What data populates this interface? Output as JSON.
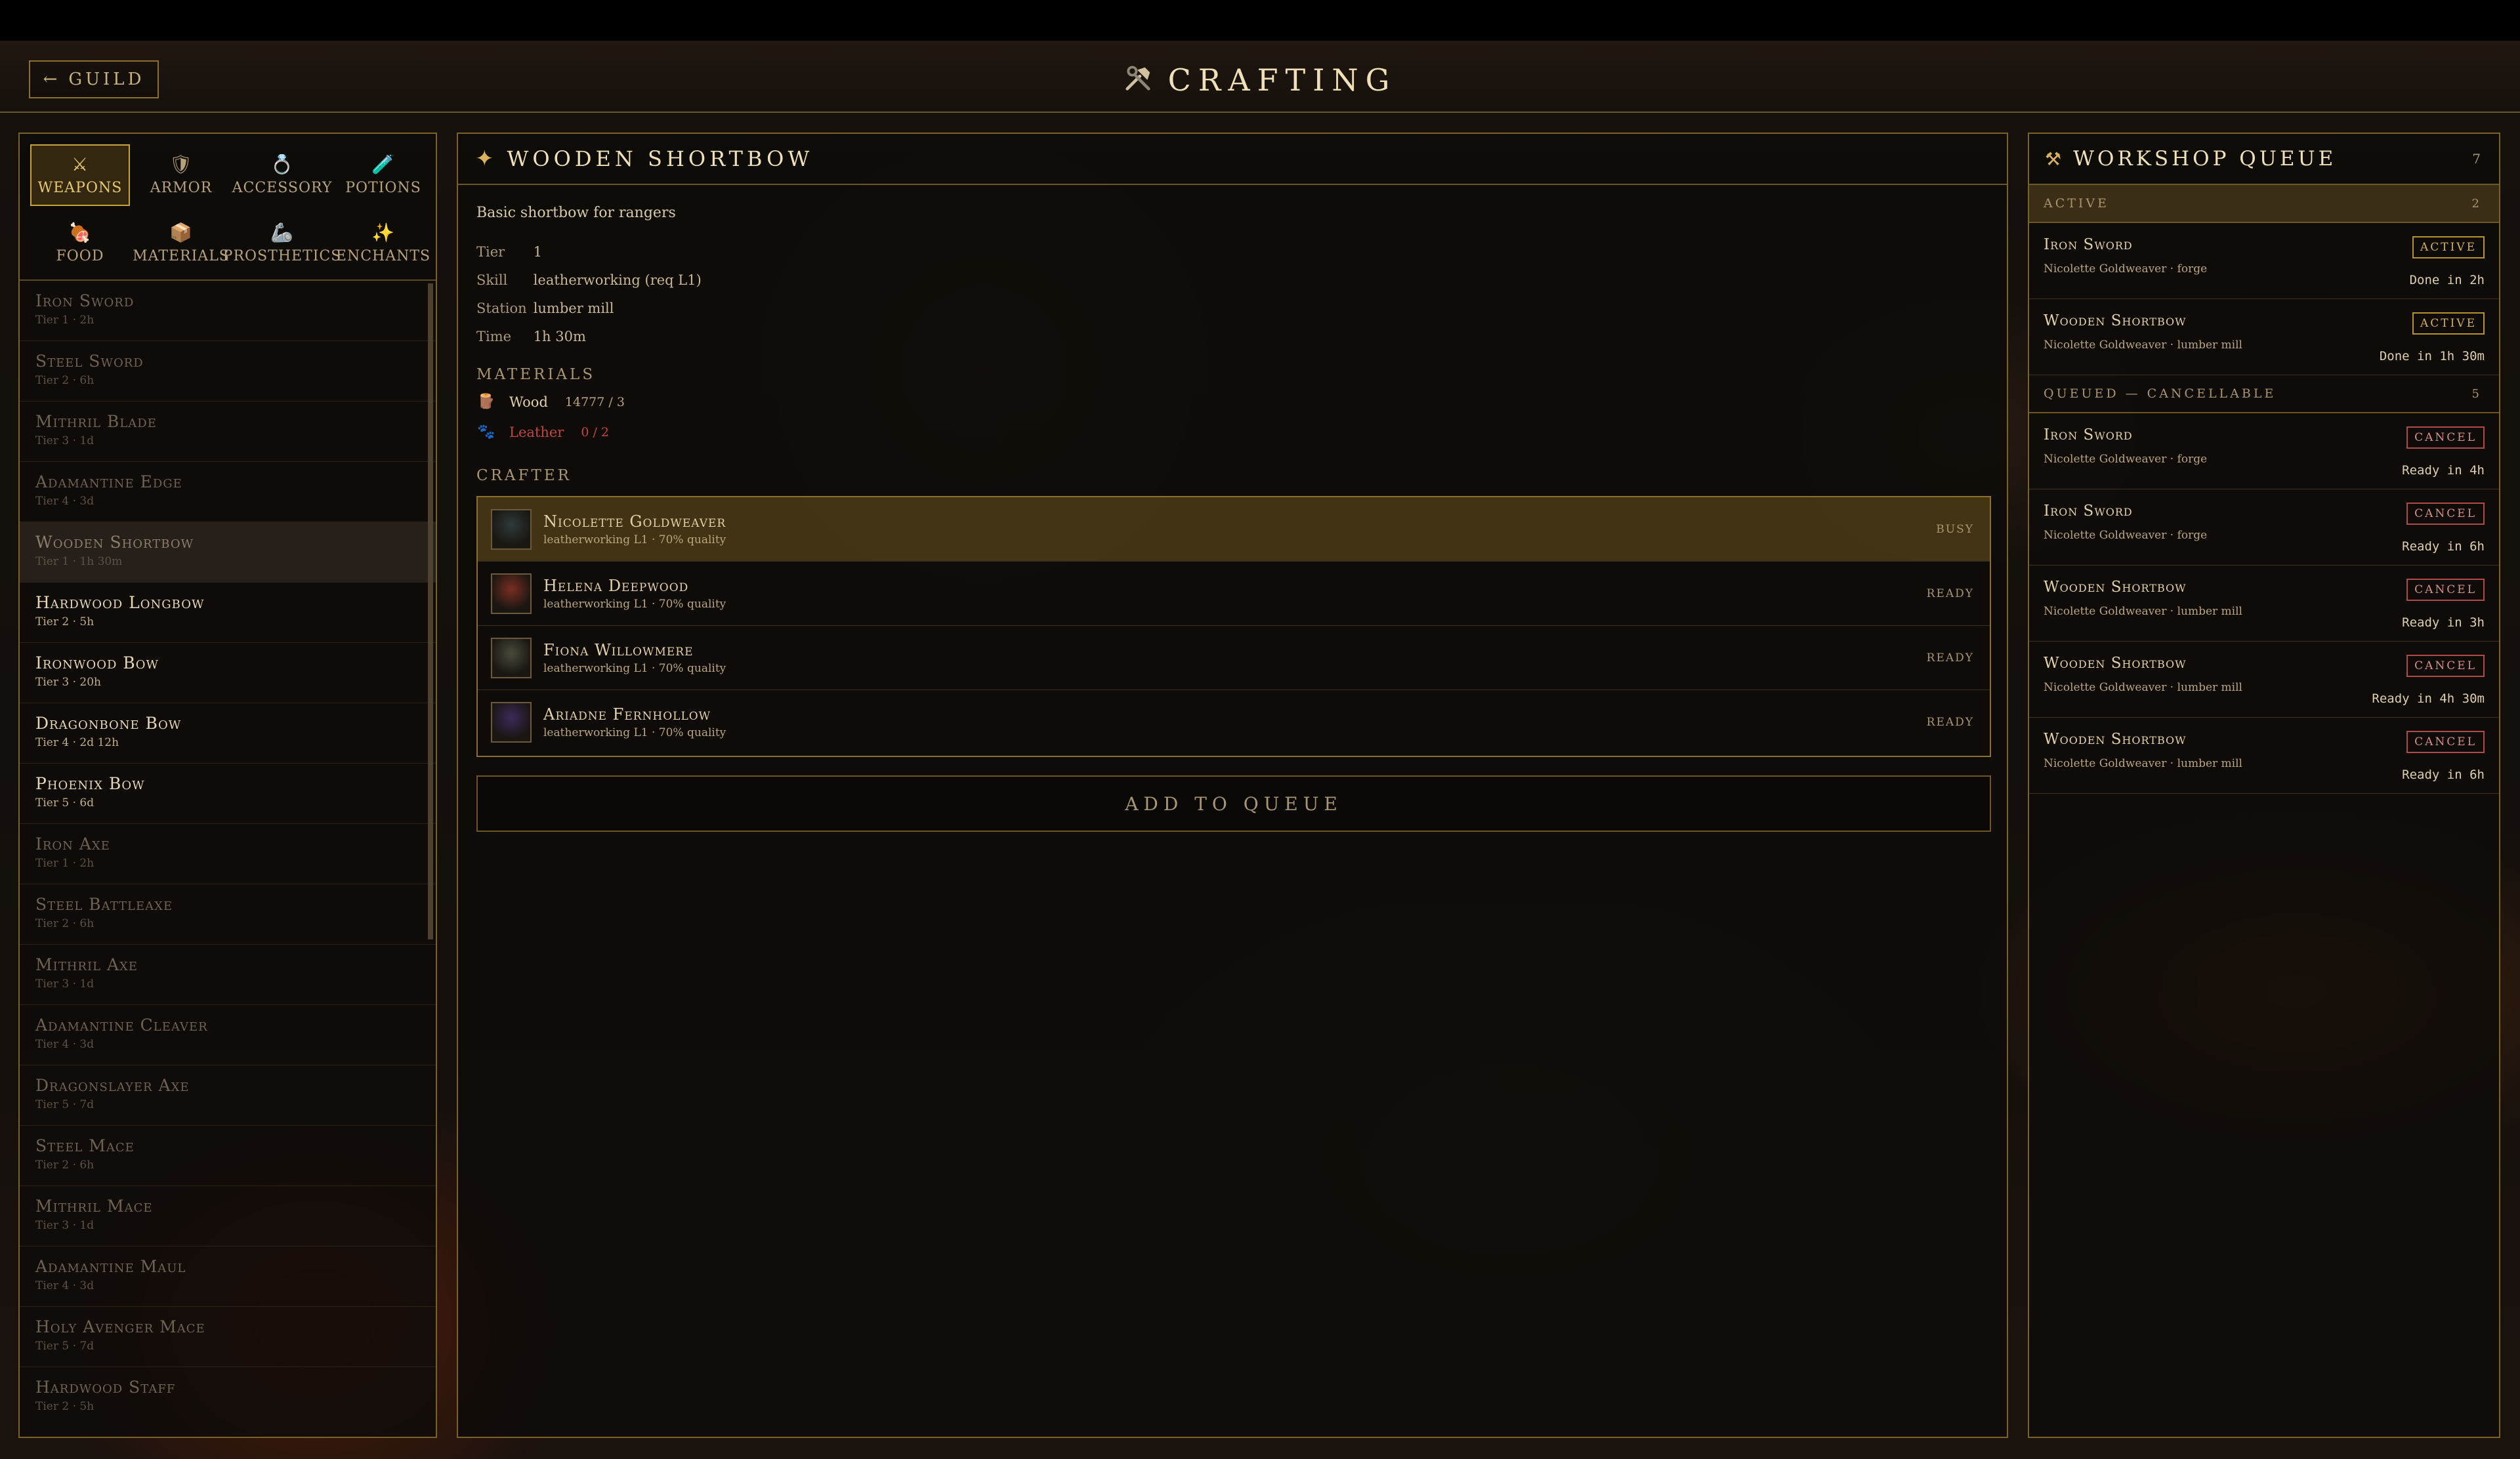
{
  "header": {
    "back_label": "GUILD",
    "back_arrow": "←",
    "title": "CRAFTING",
    "title_icon": "hammer-and-wrench-icon"
  },
  "categories": [
    {
      "label": "WEAPONS",
      "icon": "⚔",
      "selected": true
    },
    {
      "label": "ARMOR",
      "icon": "🛡",
      "selected": false
    },
    {
      "label": "ACCESSORY",
      "icon": "💍",
      "selected": false
    },
    {
      "label": "POTIONS",
      "icon": "🧪",
      "selected": false
    },
    {
      "label": "FOOD",
      "icon": "🍖",
      "selected": false
    },
    {
      "label": "MATERIALS",
      "icon": "📦",
      "selected": false
    },
    {
      "label": "PROSTHETICS",
      "icon": "🦾",
      "selected": false
    },
    {
      "label": "ENCHANTS",
      "icon": "✨",
      "selected": false
    }
  ],
  "recipes": [
    {
      "name": "Iron Sword",
      "sub": "Tier 1 · 2h",
      "bright": false,
      "selected": false
    },
    {
      "name": "Steel Sword",
      "sub": "Tier 2 · 6h",
      "bright": false,
      "selected": false
    },
    {
      "name": "Mithril Blade",
      "sub": "Tier 3 · 1d",
      "bright": false,
      "selected": false
    },
    {
      "name": "Adamantine Edge",
      "sub": "Tier 4 · 3d",
      "bright": false,
      "selected": false
    },
    {
      "name": "Wooden Shortbow",
      "sub": "Tier 1 · 1h 30m",
      "bright": false,
      "selected": true
    },
    {
      "name": "Hardwood Longbow",
      "sub": "Tier 2 · 5h",
      "bright": true,
      "selected": false
    },
    {
      "name": "Ironwood Bow",
      "sub": "Tier 3 · 20h",
      "bright": true,
      "selected": false
    },
    {
      "name": "Dragonbone Bow",
      "sub": "Tier 4 · 2d 12h",
      "bright": true,
      "selected": false
    },
    {
      "name": "Phoenix Bow",
      "sub": "Tier 5 · 6d",
      "bright": true,
      "selected": false
    },
    {
      "name": "Iron Axe",
      "sub": "Tier 1 · 2h",
      "bright": false,
      "selected": false
    },
    {
      "name": "Steel Battleaxe",
      "sub": "Tier 2 · 6h",
      "bright": false,
      "selected": false
    },
    {
      "name": "Mithril Axe",
      "sub": "Tier 3 · 1d",
      "bright": false,
      "selected": false
    },
    {
      "name": "Adamantine Cleaver",
      "sub": "Tier 4 · 3d",
      "bright": false,
      "selected": false
    },
    {
      "name": "Dragonslayer Axe",
      "sub": "Tier 5 · 7d",
      "bright": false,
      "selected": false
    },
    {
      "name": "Steel Mace",
      "sub": "Tier 2 · 6h",
      "bright": false,
      "selected": false
    },
    {
      "name": "Mithril Mace",
      "sub": "Tier 3 · 1d",
      "bright": false,
      "selected": false
    },
    {
      "name": "Adamantine Maul",
      "sub": "Tier 4 · 3d",
      "bright": false,
      "selected": false
    },
    {
      "name": "Holy Avenger Mace",
      "sub": "Tier 5 · 7d",
      "bright": false,
      "selected": false
    },
    {
      "name": "Hardwood Staff",
      "sub": "Tier 2 · 5h",
      "bright": false,
      "selected": false
    }
  ],
  "detail": {
    "star": "✦",
    "title": "WOODEN SHORTBOW",
    "description": "Basic shortbow for rangers",
    "tier_label": "Tier",
    "tier": "1",
    "skill_label": "Skill",
    "skill": "leatherworking (req L1)",
    "station_label": "Station",
    "station": "lumber mill",
    "time_label": "Time",
    "time": "1h 30m",
    "materials_heading": "MATERIALS",
    "materials": [
      {
        "name": "Wood",
        "qty": "14777 / 3",
        "icon": "🪵",
        "color": "#e2d2a8",
        "qty_color": "#b9a67c"
      },
      {
        "name": "Leather",
        "qty": "0 / 2",
        "icon": "🐾",
        "color": "#c0473f",
        "qty_color": "#c0473f"
      }
    ],
    "crafter_heading": "CRAFTER",
    "crafters": [
      {
        "name": "Nicolette Goldweaver",
        "sub": "leatherworking L1 · 70% quality",
        "status": "BUSY",
        "busy": true,
        "avatar_color": "#2e3a3a"
      },
      {
        "name": "Helena Deepwood",
        "sub": "leatherworking L1 · 70% quality",
        "status": "READY",
        "busy": false,
        "avatar_color": "#7a2e22"
      },
      {
        "name": "Fiona Willowmere",
        "sub": "leatherworking L1 · 70% quality",
        "status": "READY",
        "busy": false,
        "avatar_color": "#4a4a3a"
      },
      {
        "name": "Ariadne Fernhollow",
        "sub": "leatherworking L1 · 70% quality",
        "status": "READY",
        "busy": false,
        "avatar_color": "#3a2a5a"
      }
    ],
    "add_to_queue": "ADD TO QUEUE"
  },
  "queue": {
    "icon": "⚒",
    "title": "WORKSHOP QUEUE",
    "count": "7",
    "active_heading": "ACTIVE",
    "active_count": "2",
    "active": [
      {
        "name": "Iron Sword",
        "sub": "Nicolette Goldweaver · forge",
        "badge": "ACTIVE",
        "time": "Done in 2h"
      },
      {
        "name": "Wooden Shortbow",
        "sub": "Nicolette Goldweaver · lumber mill",
        "badge": "ACTIVE",
        "time": "Done in 1h 30m"
      }
    ],
    "queued_heading": "QUEUED — CANCELLABLE",
    "queued_count": "5",
    "queued": [
      {
        "name": "Iron Sword",
        "sub": "Nicolette Goldweaver · forge",
        "badge": "CANCEL",
        "time": "Ready in 4h"
      },
      {
        "name": "Iron Sword",
        "sub": "Nicolette Goldweaver · forge",
        "badge": "CANCEL",
        "time": "Ready in 6h"
      },
      {
        "name": "Wooden Shortbow",
        "sub": "Nicolette Goldweaver · lumber mill",
        "badge": "CANCEL",
        "time": "Ready in 3h"
      },
      {
        "name": "Wooden Shortbow",
        "sub": "Nicolette Goldweaver · lumber mill",
        "badge": "CANCEL",
        "time": "Ready in 4h 30m"
      },
      {
        "name": "Wooden Shortbow",
        "sub": "Nicolette Goldweaver · lumber mill",
        "badge": "CANCEL",
        "time": "Ready in 6h"
      }
    ]
  }
}
